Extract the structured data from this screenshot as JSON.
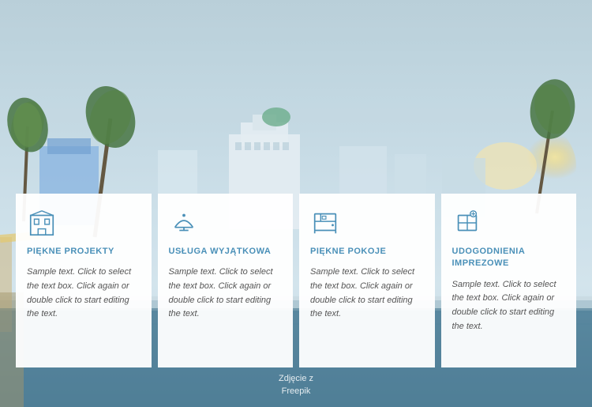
{
  "background": {
    "sky_color": "#c8dce6",
    "water_color": "#4a7a90"
  },
  "photo_credit": {
    "line1": "Zdjęcie z",
    "line2": "Freepik"
  },
  "cards": [
    {
      "id": "card-1",
      "icon": "building",
      "title": "PIĘKNE PROJEKTY",
      "text": "Sample text. Click to select the text box. Click again or double click to start editing the text."
    },
    {
      "id": "card-2",
      "icon": "service",
      "title": "USŁUGA WYJĄTKOWA",
      "text": "Sample text. Click to select the text box. Click again or double click to start editing the text."
    },
    {
      "id": "card-3",
      "icon": "room",
      "title": "PIĘKNE POKOJE",
      "text": "Sample text. Click to select the text box. Click again or double click to start editing the text."
    },
    {
      "id": "card-4",
      "icon": "amenities",
      "title": "UDOGODNIENIA IMPREZOWE",
      "text": "Sample text. Click to select the text box. Click again or double click to start editing the text."
    }
  ]
}
